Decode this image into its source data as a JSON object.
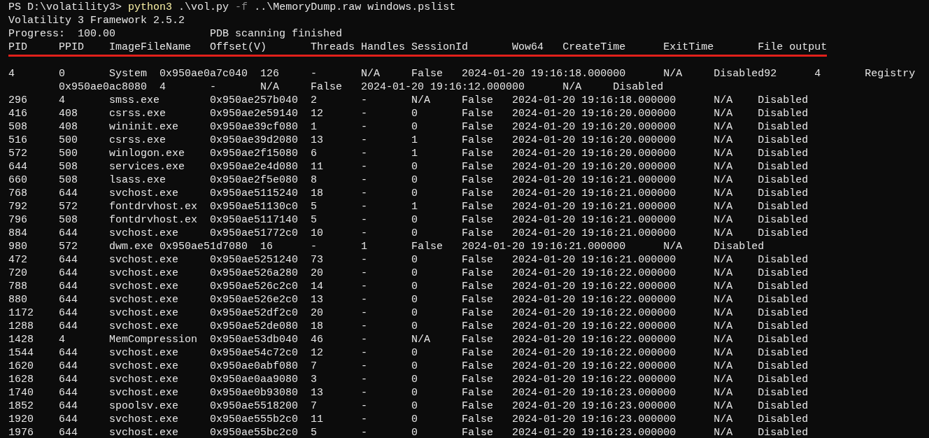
{
  "terminal": {
    "lines": [
      {
        "kind": "command",
        "prompt": "PS D:\\volatility3>",
        "program": "python3",
        "args": [
          {
            "text": ".\\vol.py",
            "kind": "plain"
          },
          {
            "text": "-f",
            "kind": "flag"
          },
          {
            "text": "..\\MemoryDump.raw",
            "kind": "plain"
          },
          {
            "text": "windows.pslist",
            "kind": "plain"
          }
        ]
      },
      {
        "kind": "text",
        "cells": [
          "Volatility 3 Framework 2.5.2"
        ]
      },
      {
        "kind": "status",
        "cells": [
          "Progress:  100.00",
          "PDB scanning finished"
        ]
      },
      {
        "kind": "header",
        "underlined": true,
        "cells": [
          "PID",
          "PPID",
          "ImageFileName",
          "Offset(V)",
          "Threads",
          "Handles",
          "SessionId",
          "Wow64",
          "CreateTime",
          "ExitTime",
          "File output"
        ]
      },
      {
        "kind": "shifted_row",
        "cells": [
          "4",
          "0",
          "System",
          "0x950ae0a7c040",
          "126",
          "-",
          "N/A",
          "False",
          "2024-01-20 19:16:18.000000",
          "N/A",
          "Disabled92",
          "4",
          "Registry"
        ]
      },
      {
        "kind": "wrapped_row",
        "cells": [
          "0x950ae0ac8080",
          "4",
          "-",
          "N/A",
          "False",
          "2024-01-20 19:16:12.000000",
          "N/A",
          "Disabled"
        ]
      },
      {
        "kind": "row",
        "cells": [
          "296",
          "4",
          "smss.exe",
          "0x950ae257b040",
          "2",
          "-",
          "N/A",
          "False",
          "2024-01-20 19:16:18.000000",
          "N/A",
          "Disabled"
        ]
      },
      {
        "kind": "row",
        "cells": [
          "416",
          "408",
          "csrss.exe",
          "0x950ae2e59140",
          "12",
          "-",
          "0",
          "False",
          "2024-01-20 19:16:20.000000",
          "N/A",
          "Disabled"
        ]
      },
      {
        "kind": "row",
        "cells": [
          "508",
          "408",
          "wininit.exe",
          "0x950ae39cf080",
          "1",
          "-",
          "0",
          "False",
          "2024-01-20 19:16:20.000000",
          "N/A",
          "Disabled"
        ]
      },
      {
        "kind": "row",
        "cells": [
          "516",
          "500",
          "csrss.exe",
          "0x950ae39d2080",
          "13",
          "-",
          "1",
          "False",
          "2024-01-20 19:16:20.000000",
          "N/A",
          "Disabled"
        ]
      },
      {
        "kind": "row",
        "cells": [
          "572",
          "500",
          "winlogon.exe",
          "0x950ae2f15080",
          "6",
          "-",
          "1",
          "False",
          "2024-01-20 19:16:20.000000",
          "N/A",
          "Disabled"
        ]
      },
      {
        "kind": "row",
        "cells": [
          "644",
          "508",
          "services.exe",
          "0x950ae2e4d080",
          "11",
          "-",
          "0",
          "False",
          "2024-01-20 19:16:20.000000",
          "N/A",
          "Disabled"
        ]
      },
      {
        "kind": "row",
        "cells": [
          "660",
          "508",
          "lsass.exe",
          "0x950ae2f5e080",
          "8",
          "-",
          "0",
          "False",
          "2024-01-20 19:16:21.000000",
          "N/A",
          "Disabled"
        ]
      },
      {
        "kind": "row",
        "cells": [
          "768",
          "644",
          "svchost.exe",
          "0x950ae5115240",
          "18",
          "-",
          "0",
          "False",
          "2024-01-20 19:16:21.000000",
          "N/A",
          "Disabled"
        ]
      },
      {
        "kind": "row",
        "cells": [
          "792",
          "572",
          "fontdrvhost.ex",
          "0x950ae51130c0",
          "5",
          "-",
          "1",
          "False",
          "2024-01-20 19:16:21.000000",
          "N/A",
          "Disabled"
        ]
      },
      {
        "kind": "row",
        "cells": [
          "796",
          "508",
          "fontdrvhost.ex",
          "0x950ae5117140",
          "5",
          "-",
          "0",
          "False",
          "2024-01-20 19:16:21.000000",
          "N/A",
          "Disabled"
        ]
      },
      {
        "kind": "row",
        "cells": [
          "884",
          "644",
          "svchost.exe",
          "0x950ae51772c0",
          "10",
          "-",
          "0",
          "False",
          "2024-01-20 19:16:21.000000",
          "N/A",
          "Disabled"
        ]
      },
      {
        "kind": "shifted_row",
        "cells": [
          "980",
          "572",
          "dwm.exe",
          "0x950ae51d7080",
          "16",
          "-",
          "1",
          "False",
          "2024-01-20 19:16:21.000000",
          "N/A",
          "Disabled"
        ]
      },
      {
        "kind": "row",
        "cells": [
          "472",
          "644",
          "svchost.exe",
          "0x950ae5251240",
          "73",
          "-",
          "0",
          "False",
          "2024-01-20 19:16:21.000000",
          "N/A",
          "Disabled"
        ]
      },
      {
        "kind": "row",
        "cells": [
          "720",
          "644",
          "svchost.exe",
          "0x950ae526a280",
          "20",
          "-",
          "0",
          "False",
          "2024-01-20 19:16:22.000000",
          "N/A",
          "Disabled"
        ]
      },
      {
        "kind": "row",
        "cells": [
          "788",
          "644",
          "svchost.exe",
          "0x950ae526c2c0",
          "14",
          "-",
          "0",
          "False",
          "2024-01-20 19:16:22.000000",
          "N/A",
          "Disabled"
        ]
      },
      {
        "kind": "row",
        "cells": [
          "880",
          "644",
          "svchost.exe",
          "0x950ae526e2c0",
          "13",
          "-",
          "0",
          "False",
          "2024-01-20 19:16:22.000000",
          "N/A",
          "Disabled"
        ]
      },
      {
        "kind": "row",
        "cells": [
          "1172",
          "644",
          "svchost.exe",
          "0x950ae52df2c0",
          "20",
          "-",
          "0",
          "False",
          "2024-01-20 19:16:22.000000",
          "N/A",
          "Disabled"
        ]
      },
      {
        "kind": "row",
        "cells": [
          "1288",
          "644",
          "svchost.exe",
          "0x950ae52de080",
          "18",
          "-",
          "0",
          "False",
          "2024-01-20 19:16:22.000000",
          "N/A",
          "Disabled"
        ]
      },
      {
        "kind": "row",
        "cells": [
          "1428",
          "4",
          "MemCompression",
          "0x950ae53db040",
          "46",
          "-",
          "N/A",
          "False",
          "2024-01-20 19:16:22.000000",
          "N/A",
          "Disabled"
        ]
      },
      {
        "kind": "row",
        "cells": [
          "1544",
          "644",
          "svchost.exe",
          "0x950ae54c72c0",
          "12",
          "-",
          "0",
          "False",
          "2024-01-20 19:16:22.000000",
          "N/A",
          "Disabled"
        ]
      },
      {
        "kind": "row",
        "cells": [
          "1620",
          "644",
          "svchost.exe",
          "0x950ae0abf080",
          "7",
          "-",
          "0",
          "False",
          "2024-01-20 19:16:22.000000",
          "N/A",
          "Disabled"
        ]
      },
      {
        "kind": "row",
        "cells": [
          "1628",
          "644",
          "svchost.exe",
          "0x950ae0aa9080",
          "3",
          "-",
          "0",
          "False",
          "2024-01-20 19:16:22.000000",
          "N/A",
          "Disabled"
        ]
      },
      {
        "kind": "row",
        "cells": [
          "1740",
          "644",
          "svchost.exe",
          "0x950ae0b93080",
          "13",
          "-",
          "0",
          "False",
          "2024-01-20 19:16:23.000000",
          "N/A",
          "Disabled"
        ]
      },
      {
        "kind": "row",
        "cells": [
          "1852",
          "644",
          "spoolsv.exe",
          "0x950ae5518200",
          "7",
          "-",
          "0",
          "False",
          "2024-01-20 19:16:23.000000",
          "N/A",
          "Disabled"
        ]
      },
      {
        "kind": "row",
        "cells": [
          "1920",
          "644",
          "svchost.exe",
          "0x950ae555b2c0",
          "11",
          "-",
          "0",
          "False",
          "2024-01-20 19:16:23.000000",
          "N/A",
          "Disabled"
        ]
      },
      {
        "kind": "row",
        "cells": [
          "1976",
          "644",
          "svchost.exe",
          "0x950ae55bc2c0",
          "5",
          "-",
          "0",
          "False",
          "2024-01-20 19:16:23.000000",
          "N/A",
          "Disabled"
        ]
      }
    ]
  }
}
